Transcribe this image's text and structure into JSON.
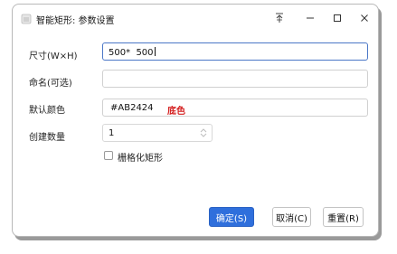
{
  "window": {
    "title": "智能矩形: 参数设置",
    "controls": {
      "pin_icon": "pin-icon",
      "minimize_icon": "minimize-icon",
      "maximize_icon": "maximize-icon",
      "close_icon": "close-icon"
    }
  },
  "form": {
    "size": {
      "label": "尺寸(W×H)",
      "value": "500*  500"
    },
    "name": {
      "label": "命名(可选)",
      "value": ""
    },
    "color": {
      "label": "默认颜色",
      "hex": "#AB2424",
      "color_name": "底色",
      "name_color": "#d42020"
    },
    "count": {
      "label": "创建数量",
      "value": "1"
    },
    "grid_option": {
      "label": "栅格化矩形",
      "checked": false
    }
  },
  "buttons": {
    "confirm_label": "确定(S)",
    "cancel_label": "取消(C)",
    "reset_label": "重置(R)",
    "accent": "#2f6fdc"
  }
}
